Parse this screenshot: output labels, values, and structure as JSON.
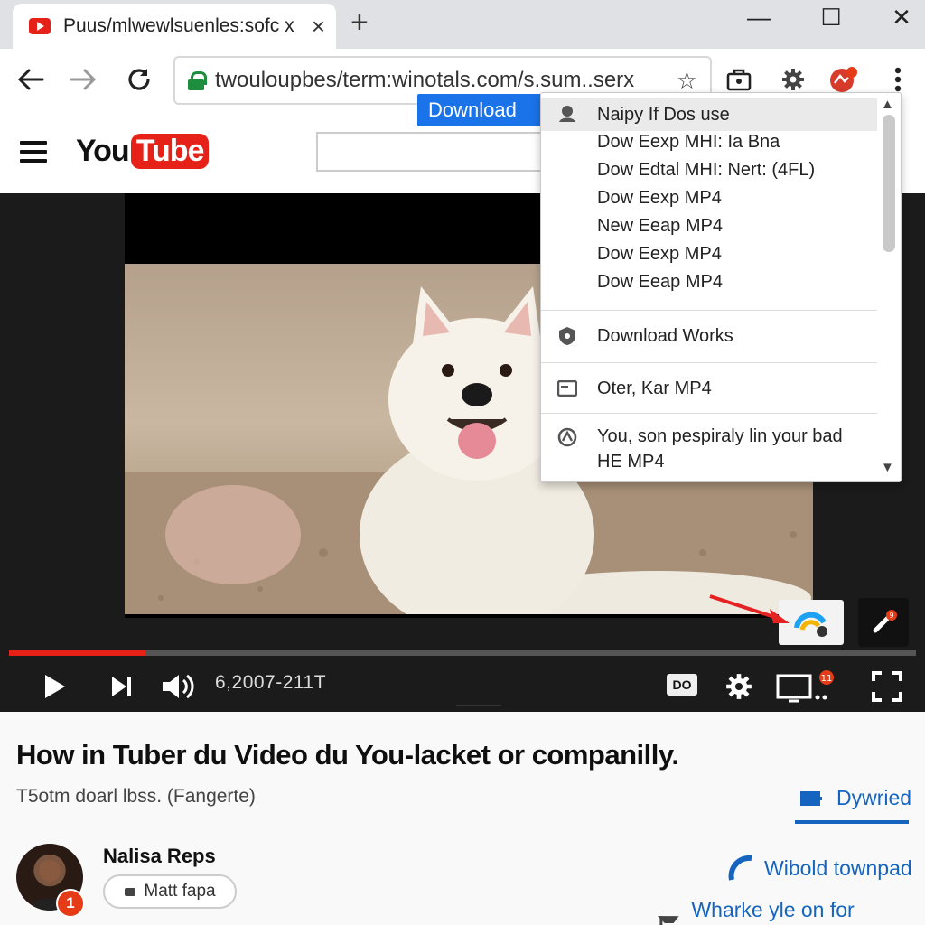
{
  "browser": {
    "tab_title": "Puus/mlwewlsuenles:sofc x",
    "tab_close": "×",
    "new_tab": "+",
    "window_controls": {
      "minimize": "—",
      "maximize": "☐",
      "close": "✕"
    },
    "url": "twouloupbes/term:winotals.com/s.sum..serx",
    "bookmark_star": "☆"
  },
  "youtube": {
    "logo_you": "You",
    "logo_tube": "Tube",
    "search_placeholder": ""
  },
  "download_pill": "Download",
  "dropdown": {
    "items": [
      {
        "label": "Naipy If Dos use",
        "icon": "download-icon"
      },
      {
        "label": "Dow Eexp MHI: Ia Bna"
      },
      {
        "label": "Dow Edtal MHI: Nert: (4FL)"
      },
      {
        "label": "Dow Eexp MP4"
      },
      {
        "label": "New Eeap MP4"
      },
      {
        "label": "Dow Eexp MP4"
      },
      {
        "label": "Dow Eeap MP4"
      },
      {
        "label": "Download Works",
        "icon": "shield-icon"
      },
      {
        "label": "Oter, Kar MP4",
        "icon": "window-icon"
      },
      {
        "label": "You, son pespiraly lin your bad",
        "label2": "HE MP4",
        "icon": "settings-circle-icon"
      }
    ]
  },
  "player": {
    "time": "6,2007-211T",
    "cc_label": "DO",
    "progress": 0.15,
    "cast_badge": "11",
    "edit_badge": "9"
  },
  "video": {
    "title": "How in Tuber du Video du You-lacket or companilly.",
    "meta": "T5otm doarl lbss. (Fangerte)"
  },
  "channel": {
    "name": "Nalisa Reps",
    "subscribe_label": "Matt fapa",
    "avatar_badge": "1"
  },
  "side_links": {
    "download": "Dywried",
    "wibold": "Wibold townpad",
    "wharke": "Wharke yle on for monory"
  },
  "colors": {
    "accent_blue": "#1a73e8",
    "youtube_red": "#e62117",
    "link_blue": "#1565c0"
  }
}
